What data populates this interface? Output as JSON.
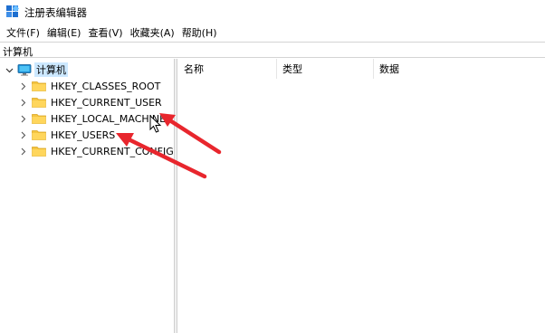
{
  "window": {
    "title": "注册表编辑器"
  },
  "menu": [
    {
      "label": "文件(F)"
    },
    {
      "label": "编辑(E)"
    },
    {
      "label": "查看(V)"
    },
    {
      "label": "收藏夹(A)"
    },
    {
      "label": "帮助(H)"
    }
  ],
  "address": {
    "path": "计算机"
  },
  "tree": {
    "root": {
      "label": "计算机",
      "expanded": true,
      "selected": true
    },
    "children": [
      {
        "label": "HKEY_CLASSES_ROOT"
      },
      {
        "label": "HKEY_CURRENT_USER"
      },
      {
        "label": "HKEY_LOCAL_MACHINE"
      },
      {
        "label": "HKEY_USERS"
      },
      {
        "label": "HKEY_CURRENT_CONFIG"
      }
    ]
  },
  "columns": [
    {
      "label": "名称"
    },
    {
      "label": "类型"
    },
    {
      "label": "数据"
    }
  ],
  "colors": {
    "folder": "#f4c542",
    "selection": "#cce8ff",
    "arrow": "#e8262d"
  }
}
